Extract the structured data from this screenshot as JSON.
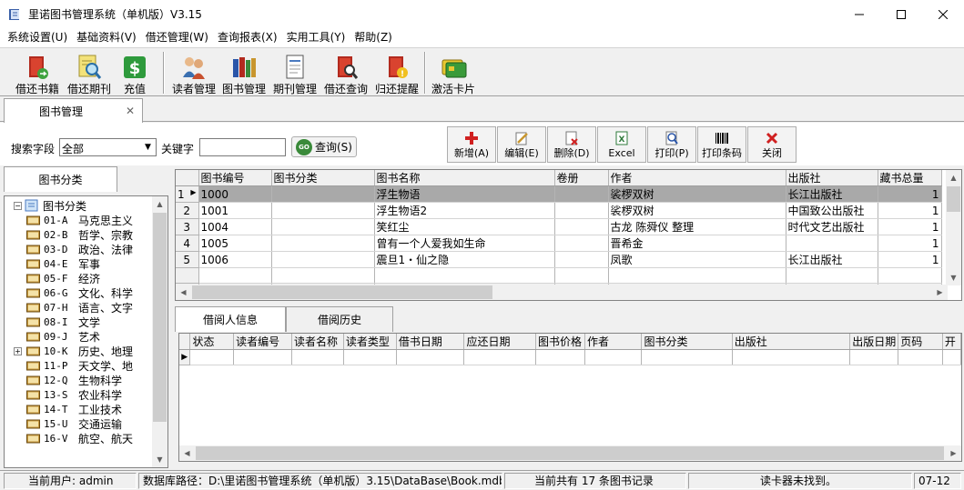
{
  "window": {
    "title": "里诺图书管理系统（单机版）V3.15"
  },
  "menu": [
    "系统设置(U)",
    "基础资料(V)",
    "借还管理(W)",
    "查询报表(X)",
    "实用工具(Y)",
    "帮助(Z)"
  ],
  "toolbar": [
    {
      "label": "借还书籍",
      "icon": "book-exchange-icon"
    },
    {
      "label": "借还期刊",
      "icon": "periodical-search-icon"
    },
    {
      "label": "充值",
      "icon": "dollar-icon"
    },
    {
      "label": "读者管理",
      "icon": "readers-icon"
    },
    {
      "label": "图书管理",
      "icon": "books-icon"
    },
    {
      "label": "期刊管理",
      "icon": "periodical-icon"
    },
    {
      "label": "借还查询",
      "icon": "loan-search-icon"
    },
    {
      "label": "归还提醒",
      "icon": "return-reminder-icon"
    },
    {
      "label": "激活卡片",
      "icon": "card-icon"
    }
  ],
  "doc_tab": {
    "label": "图书管理",
    "close": "✕"
  },
  "search": {
    "field_label": "搜索字段",
    "field_value": "全部",
    "keyword_label": "关键字",
    "keyword_value": "",
    "query_label": "查询(S)",
    "go_icon_text": "GO"
  },
  "actions": [
    {
      "label": "新增(A)",
      "icon": "plus-icon"
    },
    {
      "label": "编辑(E)",
      "icon": "edit-icon"
    },
    {
      "label": "删除(D)",
      "icon": "delete-icon"
    },
    {
      "label": "Excel",
      "icon": "excel-icon"
    },
    {
      "label": "打印(P)",
      "icon": "print-icon"
    },
    {
      "label": "打印条码",
      "icon": "barcode-icon"
    },
    {
      "label": "关闭",
      "icon": "close-icon"
    }
  ],
  "left_panel": {
    "tab_label": "图书分类",
    "root_label": "图书分类",
    "items": [
      {
        "code": "01-A",
        "name": "马克思主义"
      },
      {
        "code": "02-B",
        "name": "哲学、宗教"
      },
      {
        "code": "03-D",
        "name": "政治、法律"
      },
      {
        "code": "04-E",
        "name": "军事"
      },
      {
        "code": "05-F",
        "name": "经济"
      },
      {
        "code": "06-G",
        "name": "文化、科学"
      },
      {
        "code": "07-H",
        "name": "语言、文字"
      },
      {
        "code": "08-I",
        "name": "文学"
      },
      {
        "code": "09-J",
        "name": "艺术"
      },
      {
        "code": "10-K",
        "name": "历史、地理",
        "expandable": true
      },
      {
        "code": "11-P",
        "name": "天文学、地"
      },
      {
        "code": "12-Q",
        "name": "生物科学"
      },
      {
        "code": "13-S",
        "name": "农业科学"
      },
      {
        "code": "14-T",
        "name": "工业技术"
      },
      {
        "code": "15-U",
        "name": "交通运输"
      },
      {
        "code": "16-V",
        "name": "航空、航天"
      }
    ]
  },
  "books_table": {
    "columns": [
      "图书编号",
      "图书分类",
      "图书名称",
      "卷册",
      "作者",
      "出版社",
      "藏书总量"
    ],
    "rows": [
      {
        "idx": "1",
        "id": "1000",
        "category": "",
        "title": "浮生物语",
        "volume": "",
        "author": "裟椤双树",
        "publisher": "长江出版社",
        "total": "1"
      },
      {
        "idx": "2",
        "id": "1001",
        "category": "",
        "title": "浮生物语2",
        "volume": "",
        "author": "裟椤双树",
        "publisher": "中国致公出版社",
        "total": "1"
      },
      {
        "idx": "3",
        "id": "1004",
        "category": "",
        "title": "笑红尘",
        "volume": "",
        "author": "古龙 陈舜仪 整理",
        "publisher": "时代文艺出版社",
        "total": "1"
      },
      {
        "idx": "4",
        "id": "1005",
        "category": "",
        "title": "曾有一个人爱我如生命",
        "volume": "",
        "author": "晋希金",
        "publisher": "",
        "total": "1"
      },
      {
        "idx": "5",
        "id": "1006",
        "category": "",
        "title": "震旦1・仙之隐",
        "volume": "",
        "author": "凤歌",
        "publisher": "长江出版社",
        "total": "1"
      }
    ],
    "footer_count": "17",
    "footer_total": "17"
  },
  "sub_tabs": [
    "借阅人信息",
    "借阅历史"
  ],
  "loan_table": {
    "columns": [
      "状态",
      "读者编号",
      "读者名称",
      "读者类型",
      "借书日期",
      "应还日期",
      "图书价格",
      "作者",
      "图书分类",
      "出版社",
      "出版日期",
      "页码",
      "开"
    ]
  },
  "status": {
    "user": "当前用户: admin",
    "db_path": "数据库路径：D:\\里诺图书管理系统（单机版）3.15\\DataBase\\Book.mdb",
    "count": "当前共有 17 条图书记录",
    "reader": "读卡器未找到。",
    "date": "07-12"
  }
}
